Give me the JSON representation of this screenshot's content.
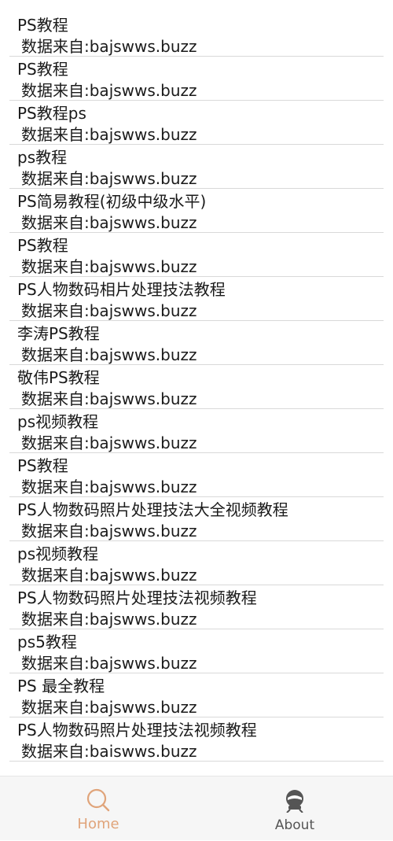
{
  "list": {
    "items": [
      {
        "title": "PS教程",
        "source": "数据来自:bajswws.buzz"
      },
      {
        "title": "PS教程",
        "source": "数据来自:bajswws.buzz"
      },
      {
        "title": "PS教程ps",
        "source": "数据来自:bajswws.buzz"
      },
      {
        "title": "ps教程",
        "source": "数据来自:bajswws.buzz"
      },
      {
        "title": "PS简易教程(初级中级水平)",
        "source": "数据来自:bajswws.buzz"
      },
      {
        "title": "PS教程",
        "source": "数据来自:bajswws.buzz"
      },
      {
        "title": "PS人物数码相片处理技法教程",
        "source": "数据来自:bajswws.buzz"
      },
      {
        "title": "李涛PS教程",
        "source": "数据来自:bajswws.buzz"
      },
      {
        "title": "敬伟PS教程",
        "source": "数据来自:bajswws.buzz"
      },
      {
        "title": "ps视频教程",
        "source": "数据来自:bajswws.buzz"
      },
      {
        "title": "PS教程",
        "source": "数据来自:bajswws.buzz"
      },
      {
        "title": "PS人物数码照片处理技法大全视频教程",
        "source": "数据来自:bajswws.buzz"
      },
      {
        "title": "ps视频教程",
        "source": "数据来自:bajswws.buzz"
      },
      {
        "title": "PS人物数码照片处理技法视频教程",
        "source": "数据来自:bajswws.buzz"
      },
      {
        "title": "ps5教程",
        "source": "数据来自:bajswws.buzz"
      },
      {
        "title": "PS 最全教程",
        "source": "数据来自:bajswws.buzz"
      },
      {
        "title": "PS人物数码照片处理技法视频教程",
        "source": "数据来自:baiswws.buzz"
      }
    ]
  },
  "tabbar": {
    "home": {
      "label": "Home",
      "icon": "search-icon",
      "color": "#e0a47a"
    },
    "about": {
      "label": "About",
      "icon": "robot-icon",
      "color": "#555555"
    }
  }
}
